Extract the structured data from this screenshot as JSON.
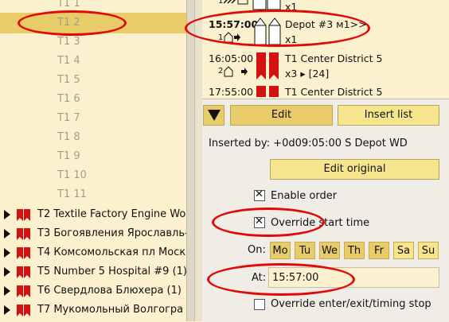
{
  "tree": {
    "sub_items": [
      "T1 1",
      "T1 2",
      "T1 3",
      "T1 4",
      "T1 5",
      "T1 6",
      "T1 7",
      "T1 8",
      "T1 9",
      "T1 10",
      "T1 11"
    ],
    "groups": [
      "T2 Textile Factory Engine Wor",
      "T3 Богоявления Ярославль-",
      "T4 Комсомольская пл Моск",
      "T5 Number 5 Hospital #9 (1)",
      "T6 Свердлова Блюхера (1)",
      "T7 Мукомольный Волгогра"
    ]
  },
  "schedule": {
    "rows": [
      {
        "idx": "1",
        "time": "",
        "dest": "",
        "count": "x1"
      },
      {
        "idx": "1",
        "time": "15:57:00",
        "dest": "Depot #3 м1>>",
        "count": "x1"
      },
      {
        "idx": "2",
        "time": "16:05:00",
        "dest": "T1 Center District 5",
        "count": "x3 ▸ [24]"
      },
      {
        "idx": "",
        "time": "17:55:00",
        "dest": "T1 Center District 5",
        "count": ""
      }
    ]
  },
  "controls": {
    "edit_label": "Edit",
    "insert_list_label": "Insert list",
    "inserted_by": "Inserted by: +0d09:05:00 S Depot WD",
    "edit_original_label": "Edit original",
    "enable_order_label": "Enable order",
    "override_start_label": "Override start time",
    "on_label": "On:",
    "days": [
      {
        "label": "Mo",
        "on": true
      },
      {
        "label": "Tu",
        "on": true
      },
      {
        "label": "We",
        "on": true
      },
      {
        "label": "Th",
        "on": true
      },
      {
        "label": "Fr",
        "on": true
      },
      {
        "label": "Sa",
        "on": false
      },
      {
        "label": "Su",
        "on": false
      }
    ],
    "at_label": "At:",
    "at_value": "15:57:00",
    "override_exit_label": "Override enter/exit/timing stop"
  },
  "colors": {
    "highlight": "#e7cc69",
    "annotation": "#e20909"
  }
}
